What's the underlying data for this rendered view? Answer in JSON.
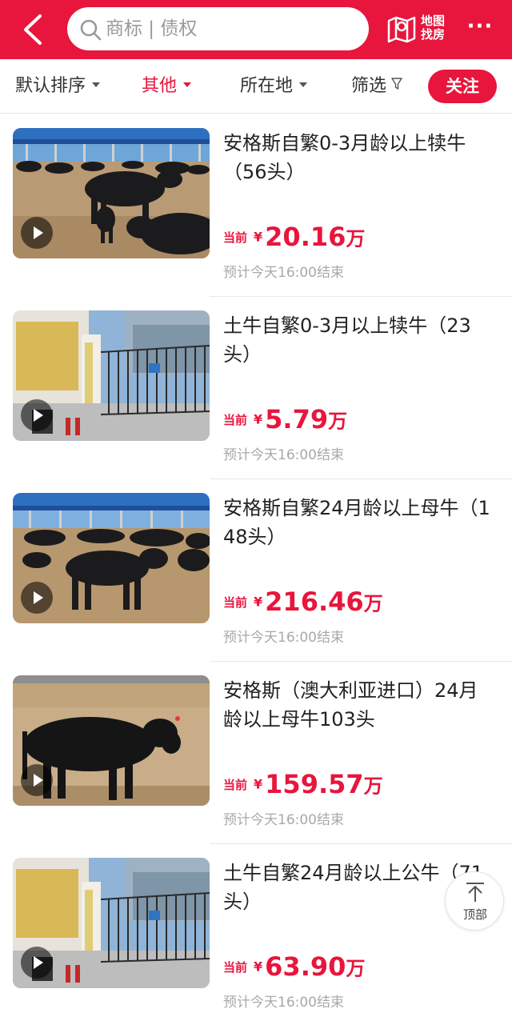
{
  "header": {
    "search_placeholder": "商标 | 债权",
    "map_label_line1": "地图",
    "map_label_line2": "找房",
    "more_label": "···"
  },
  "filters": {
    "sort": "默认排序",
    "other": "其他",
    "location": "所在地",
    "screen": "筛选",
    "follow": "关注"
  },
  "labels": {
    "price_prefix": "当前",
    "currency": "¥",
    "unit": "万"
  },
  "items": [
    {
      "title": "安格斯自繁0-3月龄以上犊牛（56头）",
      "price": "20.16",
      "end_time": "预计今天16:00结束",
      "thumbnail": "cattle-pen-photo"
    },
    {
      "title": "土牛自繁0-3月以上犊牛（23头）",
      "price": "5.79",
      "end_time": "预计今天16:00结束",
      "thumbnail": "gate-photo"
    },
    {
      "title": "安格斯自繁24月龄以上母牛（148头）",
      "price": "216.46",
      "end_time": "预计今天16:00结束",
      "thumbnail": "cattle-pen-photo"
    },
    {
      "title": "安格斯（澳大利亚进口）24月龄以上母牛103头",
      "price": "159.57",
      "end_time": "预计今天16:00结束",
      "thumbnail": "single-cow-photo"
    },
    {
      "title": "土牛自繁24月龄以上公牛（71头）",
      "price": "63.90",
      "end_time": "预计今天16:00结束",
      "thumbnail": "gate-photo"
    }
  ],
  "back_to_top": "顶部",
  "colors": {
    "brand": "#e8153c",
    "muted": "#a8a8a8"
  }
}
